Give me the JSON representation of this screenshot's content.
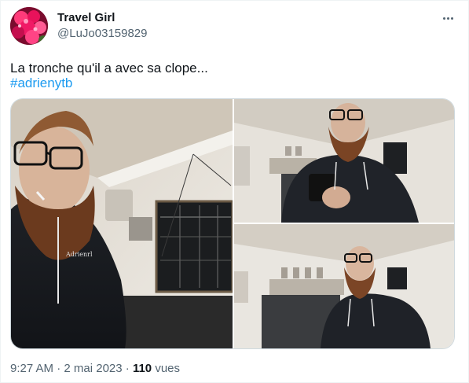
{
  "author": {
    "name": "Travel Girl",
    "handle": "@LuJo03159829"
  },
  "tweet": {
    "text": "La tronche qu'il a avec sa clope...",
    "hashtag": "#adrienytb"
  },
  "meta": {
    "time": "9:27 AM",
    "separator1": "·",
    "date": "2 mai 2023",
    "separator2": "·",
    "views_count": "110",
    "views_label": "vues"
  },
  "media": {
    "photo_count": 3
  },
  "colors": {
    "text_primary": "#0f1419",
    "text_secondary": "#536471",
    "link": "#1d9bf0",
    "border": "#cfd9de"
  },
  "icons": {
    "more": "more-horizontal-icon"
  }
}
